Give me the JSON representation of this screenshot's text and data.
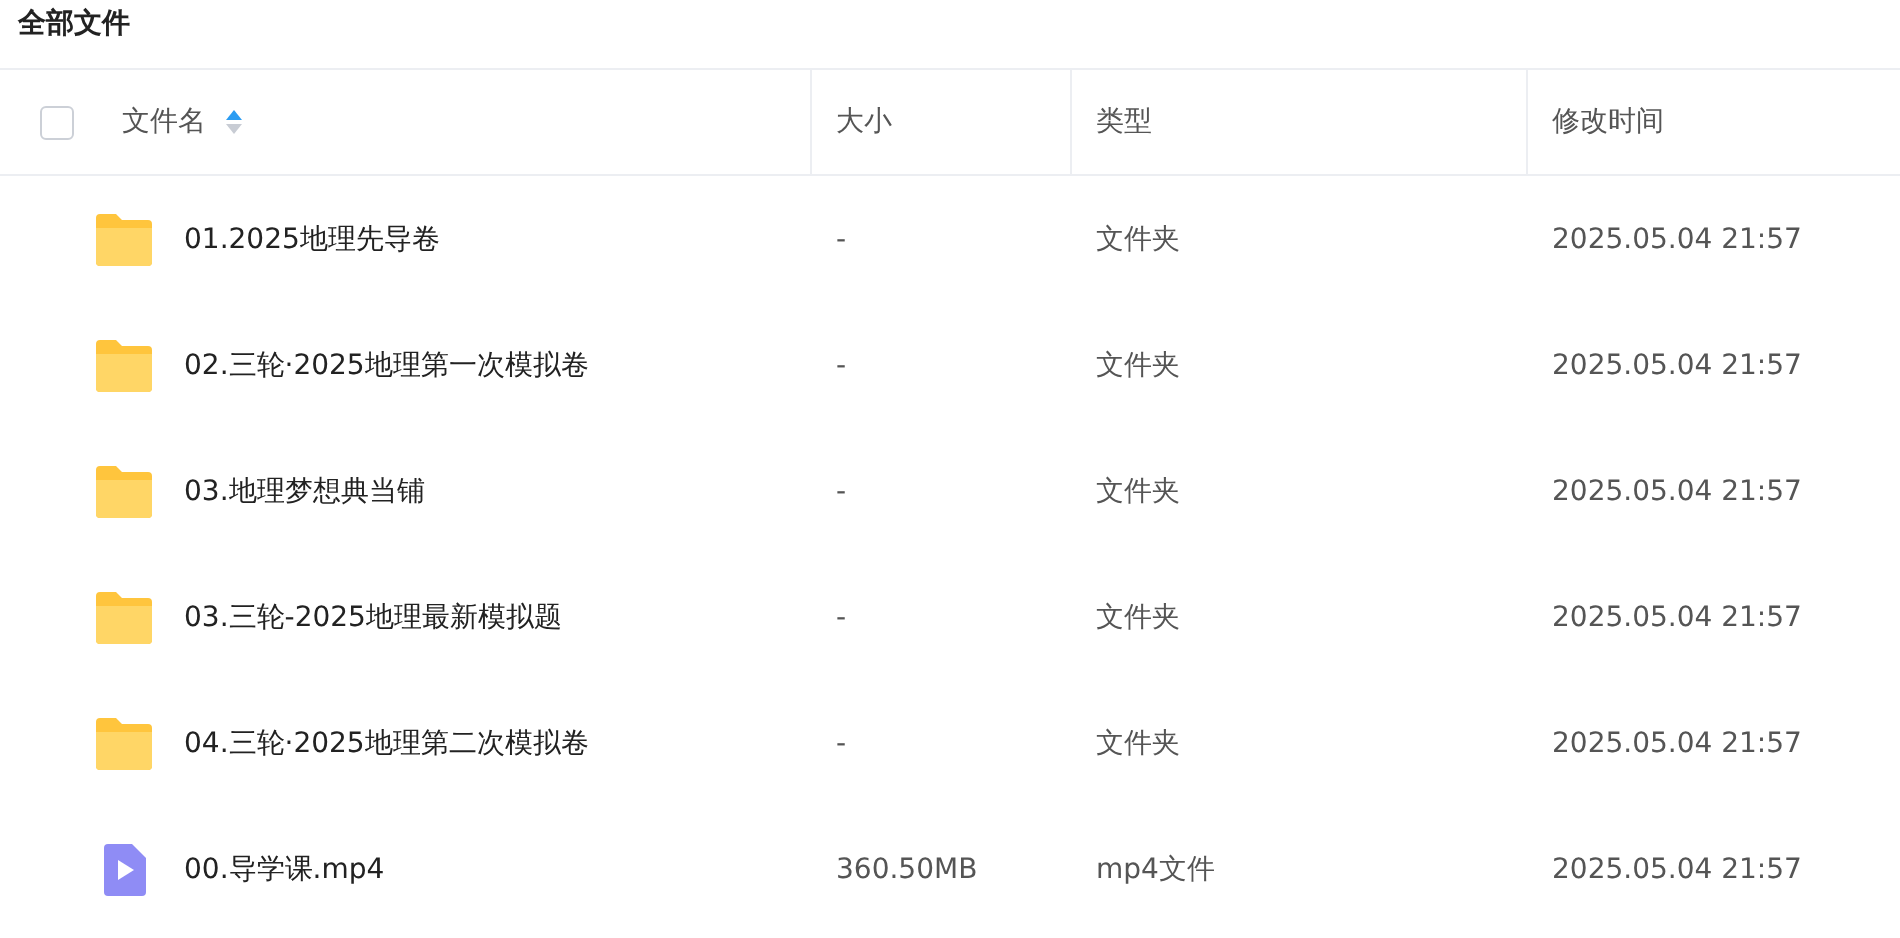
{
  "title": "全部文件",
  "table": {
    "select_all": {
      "checked": false
    },
    "columns": [
      {
        "label": "文件名",
        "sorted_ascending": true
      },
      {
        "label": "大小"
      },
      {
        "label": "类型"
      },
      {
        "label": "修改时间"
      }
    ],
    "rows": [
      {
        "kind": "folder",
        "name": "01.2025地理先导卷",
        "size": "-",
        "type": "文件夹",
        "modified": "2025.05.04 21:57"
      },
      {
        "kind": "folder",
        "name": "02.三轮·2025地理第一次模拟卷",
        "size": "-",
        "type": "文件夹",
        "modified": "2025.05.04 21:57"
      },
      {
        "kind": "folder",
        "name": "03.地理梦想典当铺",
        "size": "-",
        "type": "文件夹",
        "modified": "2025.05.04 21:57"
      },
      {
        "kind": "folder",
        "name": "03.三轮-2025地理最新模拟题",
        "size": "-",
        "type": "文件夹",
        "modified": "2025.05.04 21:57"
      },
      {
        "kind": "folder",
        "name": "04.三轮·2025地理第二次模拟卷",
        "size": "-",
        "type": "文件夹",
        "modified": "2025.05.04 21:57"
      },
      {
        "kind": "video",
        "name": "00.导学课.mp4",
        "size": "360.50MB",
        "type": "mp4文件",
        "modified": "2025.05.04 21:57"
      }
    ]
  }
}
